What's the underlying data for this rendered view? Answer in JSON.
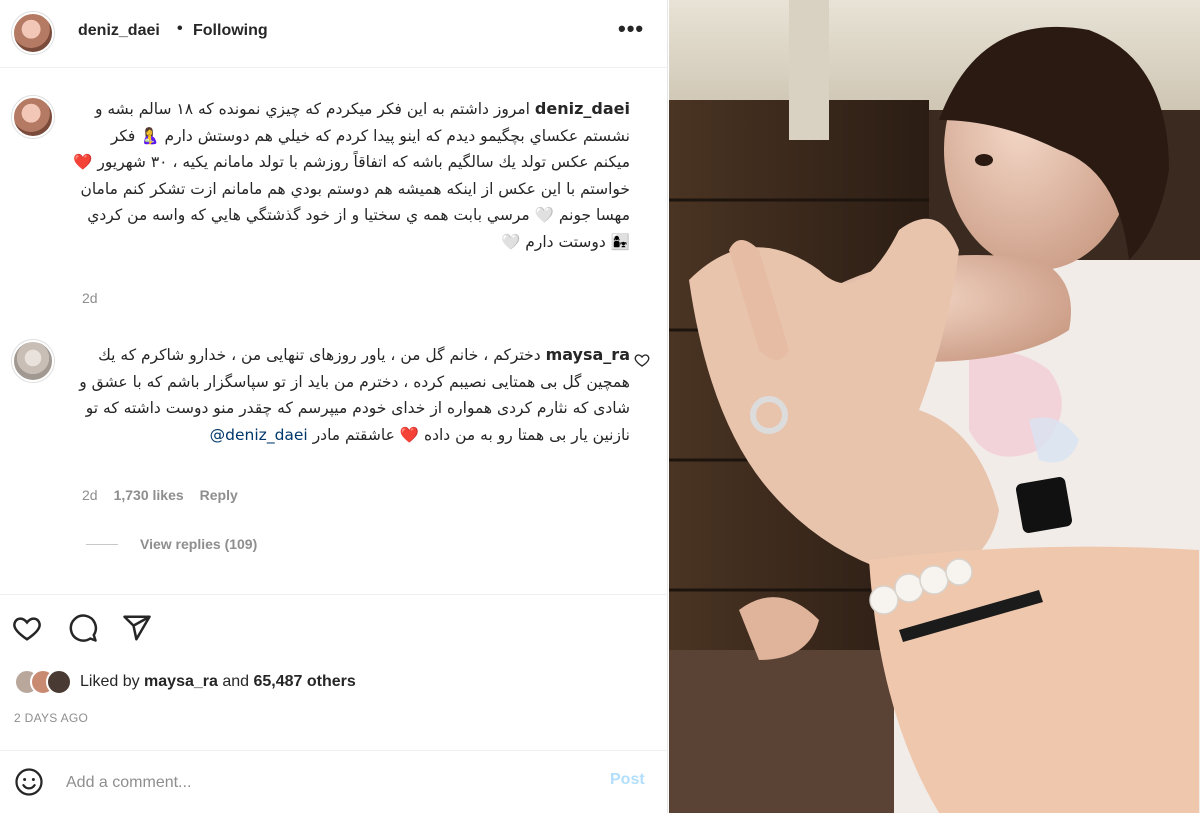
{
  "post": {
    "username": "deniz_daei",
    "dot": "•",
    "follow_status": "Following",
    "more": "•••"
  },
  "caption": {
    "username": "deniz_daei",
    "text": "امروز داشتم به این فکر میکردم که چیزي نمونده که ۱۸ سالم بشه و نشستم عکساي بچگيمو ديدم که اينو پيدا کردم که خيلي هم دوستش دارم 🤱 فکر ميکنم عکس تولد يك سالگيم باشه که اتفاقاً روزشم با تولد مامانم يکيه ، ۳۰ شهريور ❤️ خواستم با اين عکس از اينکه هميشه هم دوستم بودي هم مامانم ازت تشکر کنم مامان مهسا جونم 🤍 مرسي بابت همه ي سختيا و از خود گذشتگي هايي که واسه من کردي 👩‍👧 دوستت دارم 🤍",
    "time": "2d"
  },
  "comment": {
    "username": "maysa_ra",
    "text": "دخترکم ، خانم گل من ، یاور روزهای تنهایی من ، خدارو شاکرم که یك همچین گل بی همتایی نصیبم کرده ، دخترم من باید از تو سپاسگزار باشم که با عشق و شادی که نثارم کردی همواره از خدای خودم میپرسم که چقدر منو دوست داشته که تو نازنین یار بی همتا رو به من داده ❤️ عاشقتم مادر",
    "mention": "@deniz_daei",
    "time": "2d",
    "likes": "1,730 likes",
    "reply": "Reply",
    "view_replies": "View replies (109)"
  },
  "likes": {
    "prefix": "Liked by",
    "user": "maysa_ra",
    "and": "and",
    "others": "65,487 others"
  },
  "date": "2 DAYS AGO",
  "add_comment": {
    "placeholder": "Add a comment...",
    "post_label": "Post"
  },
  "colors": {
    "text": "#262626",
    "muted": "#8e8e8e",
    "link": "#00376b",
    "post_disabled": "#b2dffc"
  }
}
